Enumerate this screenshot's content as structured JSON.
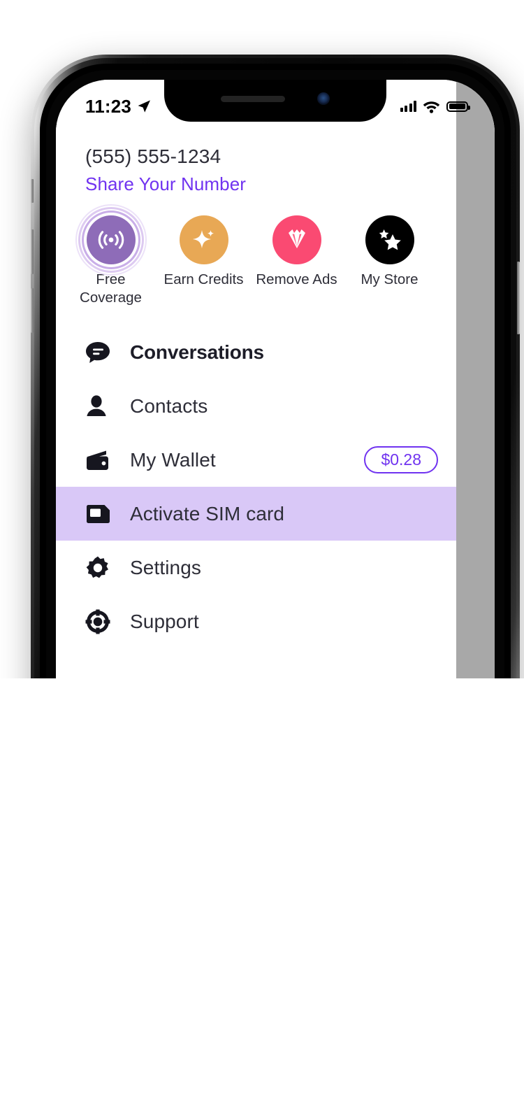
{
  "status_bar": {
    "clock": "11:23",
    "location_icon": "location-arrow-icon",
    "signal_icon": "cellular-signal-icon",
    "wifi_icon": "wifi-icon",
    "battery_icon": "battery-full-icon"
  },
  "drawer": {
    "phone_number": "(555) 555-1234",
    "share_link": "Share Your Number",
    "quick_actions": [
      {
        "label_line1": "Free",
        "label_line2": "Coverage",
        "icon": "broadcast-signal-icon",
        "color": "#8e6cb8",
        "active": true
      },
      {
        "label_line1": "Earn Credits",
        "label_line2": "",
        "icon": "sparkle-icon",
        "color": "#e8a855",
        "active": false
      },
      {
        "label_line1": "Remove Ads",
        "label_line2": "",
        "icon": "diamond-icon",
        "color": "#fa4a72",
        "active": false
      },
      {
        "label_line1": "My Store",
        "label_line2": "",
        "icon": "stars-icon",
        "color": "#000000",
        "active": false
      }
    ],
    "menu_items": [
      {
        "label": "Conversations",
        "icon": "chat-bubble-icon",
        "bold": true,
        "highlighted": false,
        "badge": ""
      },
      {
        "label": "Contacts",
        "icon": "person-icon",
        "bold": false,
        "highlighted": false,
        "badge": ""
      },
      {
        "label": "My Wallet",
        "icon": "wallet-icon",
        "bold": false,
        "highlighted": false,
        "badge": "$0.28"
      },
      {
        "label": "Activate SIM card",
        "icon": "sim-card-icon",
        "bold": false,
        "highlighted": true,
        "badge": ""
      },
      {
        "label": "Settings",
        "icon": "gear-icon",
        "bold": false,
        "highlighted": false,
        "badge": ""
      },
      {
        "label": "Support",
        "icon": "life-ring-icon",
        "bold": false,
        "highlighted": false,
        "badge": ""
      }
    ]
  },
  "background_app": {
    "menu_icon": "hamburger-menu-icon",
    "search_icon": "search-icon",
    "avatars": [
      {
        "name": "contact-avatar",
        "color": "#5c4436"
      },
      {
        "name": "chat-avatar",
        "color": "#8d2bb0"
      }
    ]
  },
  "colors": {
    "accent_purple": "#7033f0",
    "highlight_lavender": "#d9c8f7",
    "text_dark": "#2e2e38",
    "dim_overlay": "#a8a8a8"
  }
}
